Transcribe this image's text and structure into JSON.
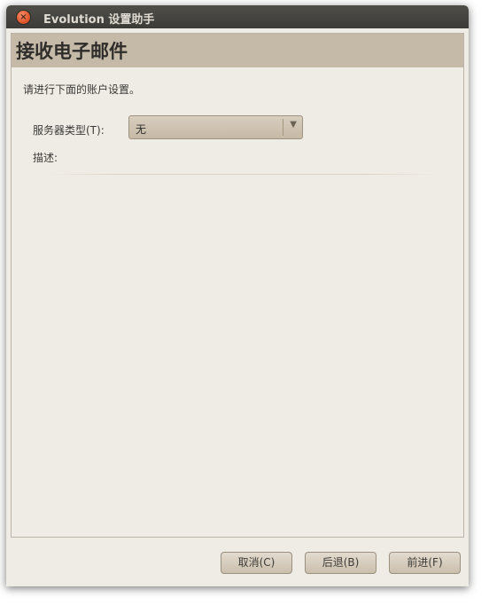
{
  "window": {
    "title": "Evolution 设置助手",
    "close_glyph": "×"
  },
  "page": {
    "title": "接收电子邮件",
    "intro": "请进行下面的账户设置。"
  },
  "form": {
    "server_type_label": "服务器类型(T):",
    "server_type_value": "无",
    "description_label": "描述:"
  },
  "buttons": {
    "cancel": "取消(C)",
    "back": "后退(B)",
    "forward": "前进(F)"
  },
  "icons": {
    "close": "close-icon",
    "dropdown": "chevron-down-icon"
  },
  "colors": {
    "titlebar": "#3c3b37",
    "header_band": "#c5b9a8",
    "window_bg": "#efebe5",
    "close_button": "#e2572b"
  }
}
